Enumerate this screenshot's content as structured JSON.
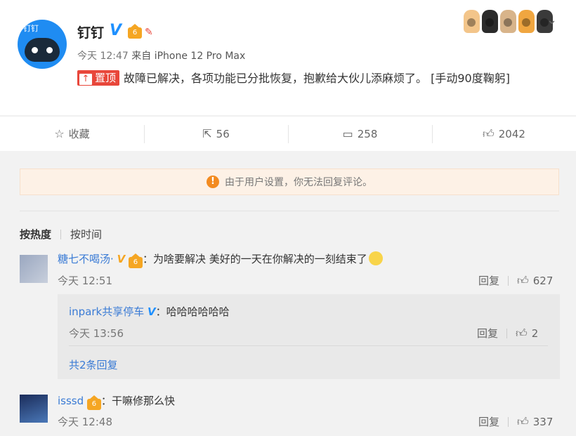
{
  "post": {
    "author": "钉钉",
    "avatar_logo": "钉钉",
    "time": "今天 12:47",
    "source": "来自 iPhone 12 Pro Max",
    "pin_label": "置顶",
    "content": "故障已解决，各项功能已分批恢复，抱歉给大伙儿添麻烦了。 [手动90度鞠躬]",
    "icons": [
      "verified-v-icon",
      "vip-crown-icon",
      "tag-icon",
      "paw-icons",
      "chevron-down-icon"
    ]
  },
  "actions": {
    "favorite_label": "收藏",
    "repost_count": "56",
    "comment_count": "258",
    "like_count": "2042"
  },
  "notice": {
    "text": "由于用户设置，你无法回复评论。"
  },
  "sort": {
    "by_hot": "按热度",
    "by_time": "按时间"
  },
  "comments": [
    {
      "user": "糖七不喝汤·",
      "text": "为啥要解决 美好的一天在你解决的一刻结束了",
      "time": "今天 12:51",
      "reply_label": "回复",
      "likes": "627",
      "replies": [
        {
          "user": "inpark共享停车",
          "text": "哈哈哈哈哈哈",
          "time": "今天 13:56",
          "reply_label": "回复",
          "likes": "2"
        }
      ],
      "more_label": "共2条回复"
    },
    {
      "user": "isssd",
      "text": "干嘛修那么快",
      "time": "今天 12:48",
      "reply_label": "回复",
      "likes": "337"
    }
  ],
  "colors": {
    "accent": "#3a7bd5",
    "pin": "#e8473b",
    "warn": "#f38b20",
    "vip": "#f5a623"
  }
}
